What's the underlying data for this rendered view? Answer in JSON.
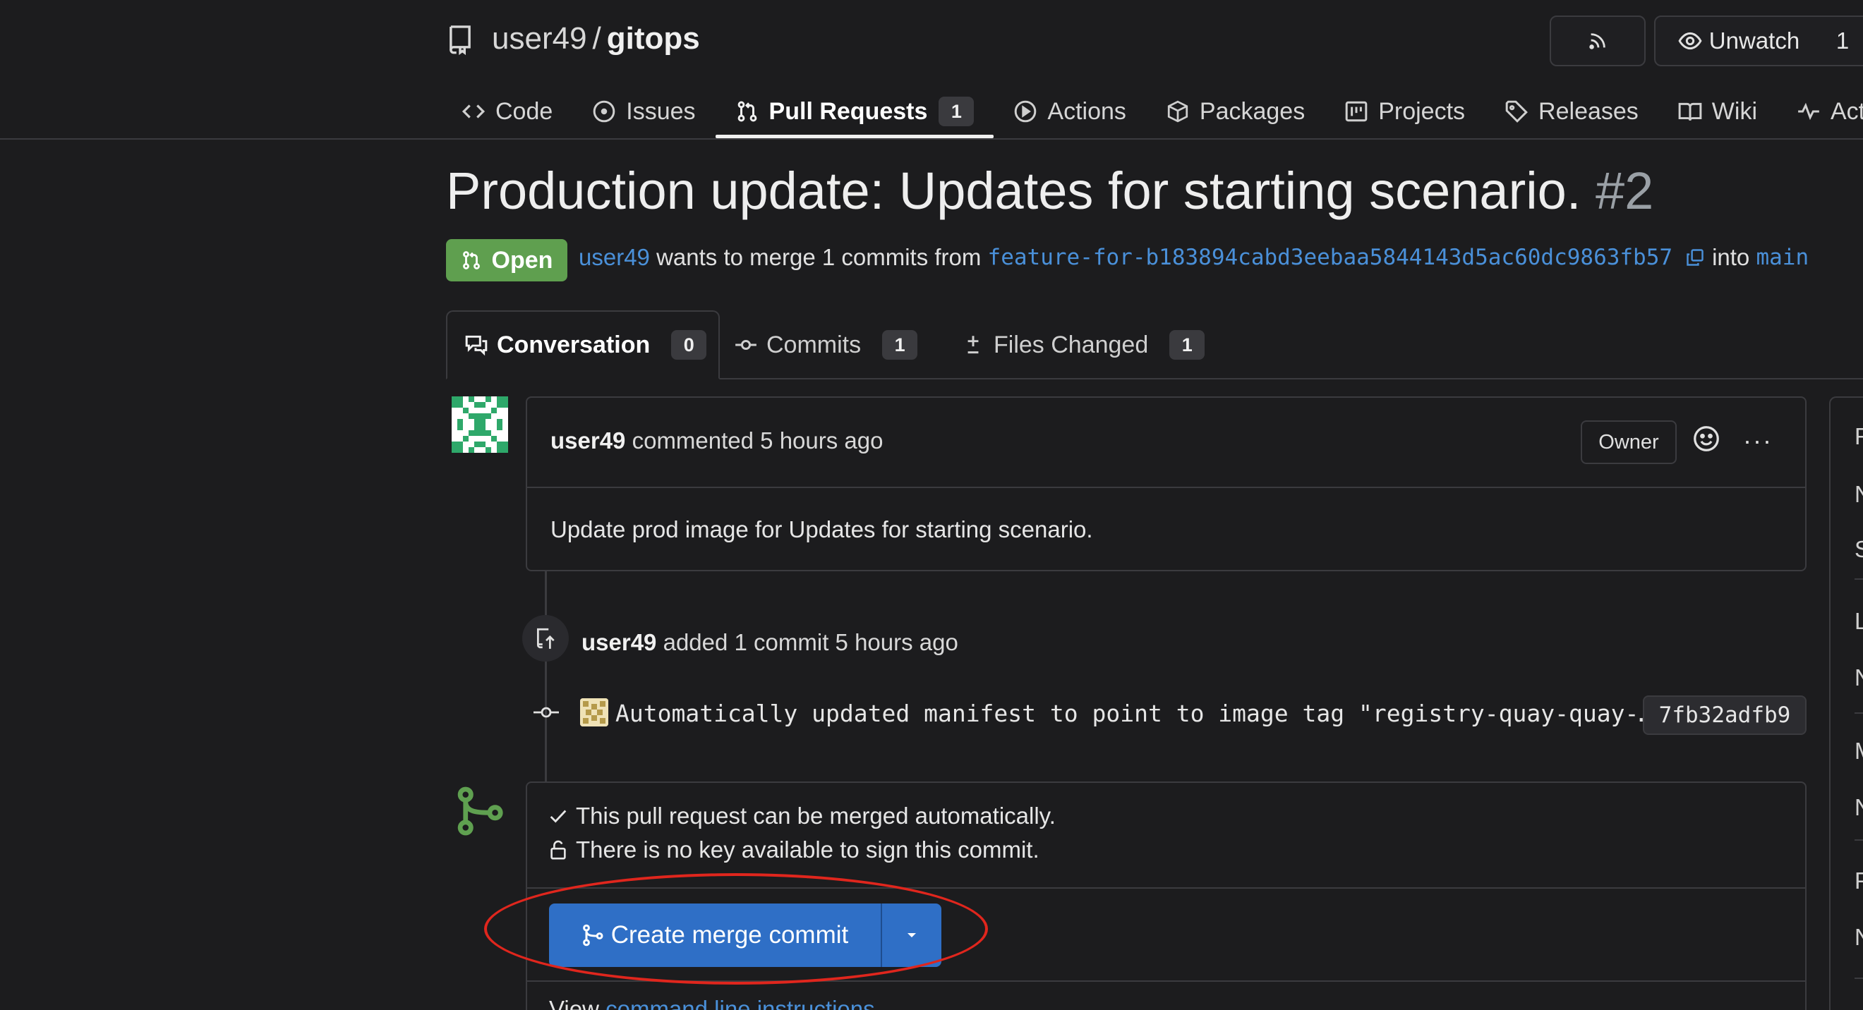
{
  "repo": {
    "owner": "user49",
    "separator": "/",
    "name": "gitops"
  },
  "header_buttons": {
    "rss_label": "",
    "unwatch_label": "Unwatch",
    "watch_count": "1"
  },
  "nav": {
    "tabs": [
      {
        "label": "Code",
        "icon": "code-icon"
      },
      {
        "label": "Issues",
        "icon": "issue-icon"
      },
      {
        "label": "Pull Requests",
        "icon": "pull-request-icon",
        "count": "1",
        "active": true
      },
      {
        "label": "Actions",
        "icon": "play-icon"
      },
      {
        "label": "Packages",
        "icon": "package-icon"
      },
      {
        "label": "Projects",
        "icon": "project-icon"
      },
      {
        "label": "Releases",
        "icon": "tag-icon"
      },
      {
        "label": "Wiki",
        "icon": "book-icon"
      },
      {
        "label": "Activity",
        "icon": "pulse-icon"
      }
    ]
  },
  "pr": {
    "title": "Production update: Updates for starting scenario.",
    "number": "#2",
    "state": "Open",
    "author": "user49",
    "merge_text": "wants to merge 1 commits from",
    "head_branch": "feature-for-b183894cabd3eebaa5844143d5ac60dc9863fb57",
    "into_text": "into",
    "base_branch": "main"
  },
  "pr_tabs": [
    {
      "label": "Conversation",
      "count": "0",
      "icon": "comment-discussion-icon",
      "active": true
    },
    {
      "label": "Commits",
      "count": "1",
      "icon": "commit-icon"
    },
    {
      "label": "Files Changed",
      "count": "1",
      "icon": "diff-icon"
    }
  ],
  "comment": {
    "author": "user49",
    "action": "commented 5 hours ago",
    "role_badge": "Owner",
    "body": "Update prod image for Updates for starting scenario.",
    "more_label": "···"
  },
  "timeline": {
    "event_author": "user49",
    "event_text": "added 1 commit 5 hours ago",
    "commit_message": "Automatically updated manifest to point to image tag \"registry-quay-quay-…",
    "commit_sha": "7fb32adfb9"
  },
  "merge": {
    "status_line": "This pull request can be merged automatically.",
    "sign_line": "There is no key available to sign this commit.",
    "button_label": "Create merge commit",
    "hint_prefix": "View",
    "hint_link": "command line instructions",
    "hint_suffix": "."
  },
  "sidebar_peek": [
    "R",
    "N",
    "S",
    "L",
    "N",
    "M",
    "N",
    "P",
    "N"
  ],
  "colors": {
    "background": "#1c1c1e",
    "border": "#3b3b3f",
    "open_badge": "#5f9f4f",
    "link": "#4a90d9",
    "merge_button": "#2f6fc6",
    "annotation_ellipse": "#e0261d"
  }
}
